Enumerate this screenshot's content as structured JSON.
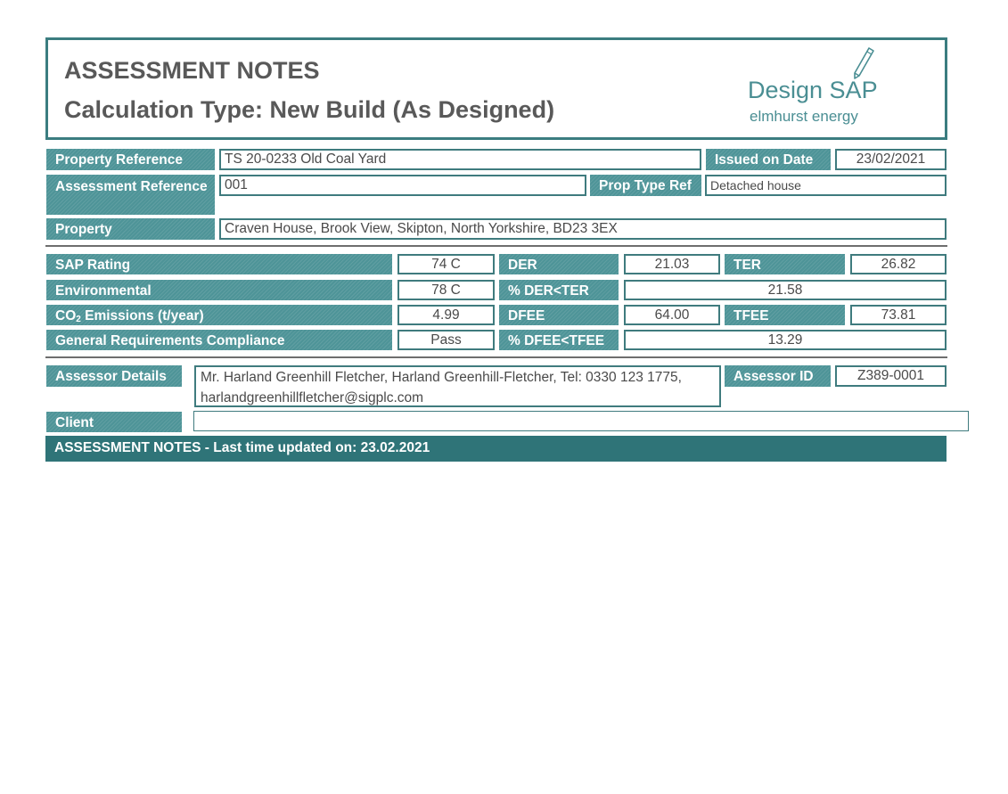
{
  "header": {
    "title": "ASSESSMENT NOTES",
    "subtitle": "Calculation Type: New Build (As Designed)",
    "logo_main": "Design SAP",
    "logo_sub": "elmhurst energy",
    "logo_icon": "pencil-icon"
  },
  "property_info": {
    "property_reference_label": "Property Reference",
    "property_reference_value": "TS 20-0233 Old Coal Yard",
    "issued_on_date_label": "Issued on Date",
    "issued_on_date_value": "23/02/2021",
    "assessment_reference_label": "Assessment Reference",
    "assessment_reference_value": "001",
    "prop_type_ref_label": "Prop Type Ref",
    "prop_type_ref_value": "Detached house",
    "property_label": "Property",
    "property_value": "Craven House, Brook View, Skipton, North Yorkshire, BD23 3EX"
  },
  "ratings": {
    "sap_rating_label": "SAP Rating",
    "sap_rating_value": "74 C",
    "environmental_label": "Environmental",
    "environmental_value": "78 C",
    "co2_label_prefix": "CO",
    "co2_label_sub": "2",
    "co2_label_suffix": " Emissions (t/year)",
    "co2_value": "4.99",
    "general_requirements_label": "General Requirements Compliance",
    "general_requirements_value": "Pass",
    "der_label": "DER",
    "der_value": "21.03",
    "ter_label": "TER",
    "ter_value": "26.82",
    "der_ter_label": "% DER<TER",
    "der_ter_value": "21.58",
    "dfee_label": "DFEE",
    "dfee_value": "64.00",
    "tfee_label": "TFEE",
    "tfee_value": "73.81",
    "dfee_tfee_label": "% DFEE<TFEE",
    "dfee_tfee_value": "13.29"
  },
  "assessor": {
    "details_label": "Assessor Details",
    "details_value": "Mr. Harland Greenhill Fletcher, Harland Greenhill-Fletcher, Tel: 0330 123 1775, harlandgreenhillfletcher@sigplc.com",
    "id_label": "Assessor ID",
    "id_value": "Z389-0001",
    "client_label": "Client",
    "client_value": ""
  },
  "footer": {
    "notes_bar": "ASSESSMENT NOTES - Last time updated on: 23.02.2021"
  },
  "colors": {
    "header_border": "#3b7d80",
    "label_bg": "#4e9498",
    "footer_bg": "#2f7478",
    "logo": "#4a8e93"
  }
}
